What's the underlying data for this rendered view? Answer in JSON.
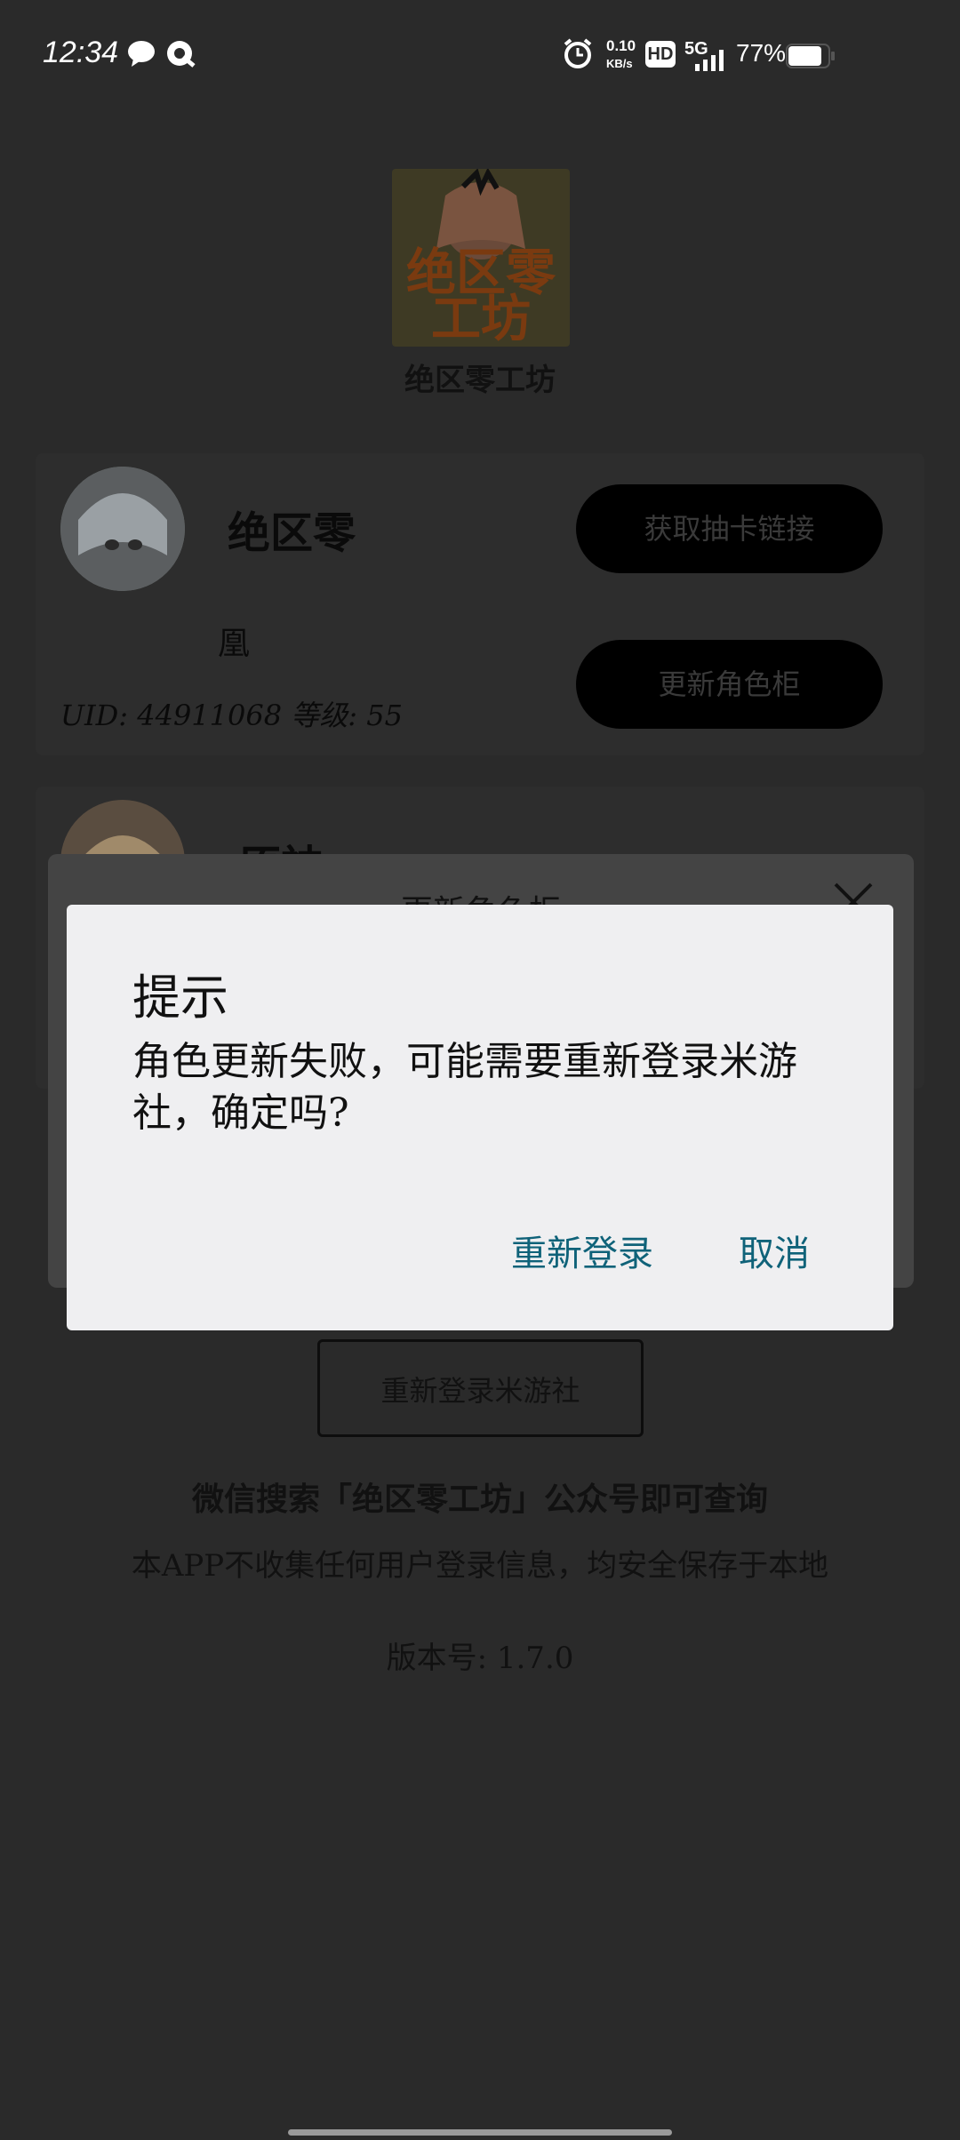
{
  "status_bar": {
    "time": "12:34",
    "net_speed_value": "0.10",
    "net_speed_unit": "KB/s",
    "hd": "HD",
    "network": "5G",
    "battery": "77%"
  },
  "app": {
    "logo_line1": "绝区零",
    "logo_line2": "工坊",
    "name": "绝区零工坊"
  },
  "cards": [
    {
      "game": "绝区零",
      "character": "凰",
      "uid_line": "UID: 44911068 等级: 55",
      "buttons": [
        "获取抽卡链接",
        "更新角色柜"
      ]
    },
    {
      "game": "原神"
    }
  ],
  "bg_dialog": {
    "title": "更新角色柜"
  },
  "relogin_button": "重新登录米游社",
  "footer": {
    "wechat_hint": "微信搜索「绝区零工坊」公众号即可查询",
    "privacy": "本APP不收集任何用户登录信息，均安全保存于本地",
    "version": "版本号: 1.7.0"
  },
  "alert": {
    "title": "提示",
    "message": "角色更新失败，可能需要重新登录米游社，确定吗?",
    "confirm": "重新登录",
    "cancel": "取消"
  },
  "colors": {
    "accent": "#0f6279",
    "background": "#2a2a2a",
    "dialog": "#efeff1"
  }
}
